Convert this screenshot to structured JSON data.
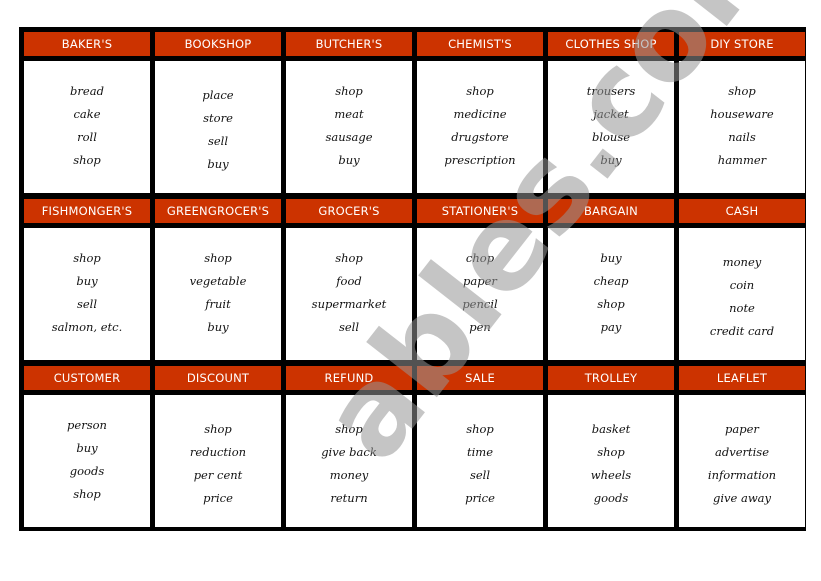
{
  "worksheet": {
    "watermark": "ables.com",
    "cards": [
      {
        "title": "BAKER'S",
        "words": [
          "bread",
          "cake",
          "roll",
          "shop"
        ]
      },
      {
        "title": "BOOKSHOP",
        "words": [
          "place",
          "store",
          "sell",
          "buy"
        ]
      },
      {
        "title": "BUTCHER'S",
        "words": [
          "shop",
          "meat",
          "sausage",
          "buy"
        ]
      },
      {
        "title": "CHEMIST'S",
        "words": [
          "shop",
          "medicine",
          "drugstore",
          "prescription"
        ]
      },
      {
        "title": "CLOTHES SHOP",
        "words": [
          "trousers",
          "jacket",
          "blouse",
          "buy"
        ]
      },
      {
        "title": "DIY STORE",
        "words": [
          "shop",
          "houseware",
          "nails",
          "hammer"
        ]
      },
      {
        "title": "FISHMONGER'S",
        "words": [
          "shop",
          "buy",
          "sell",
          "salmon, etc."
        ]
      },
      {
        "title": "GREENGROCER'S",
        "words": [
          "shop",
          "vegetable",
          "fruit",
          "buy"
        ]
      },
      {
        "title": "GROCER'S",
        "words": [
          "shop",
          "food",
          "supermarket",
          "sell"
        ]
      },
      {
        "title": "STATIONER'S",
        "words": [
          "chop",
          "paper",
          "pencil",
          "pen"
        ]
      },
      {
        "title": "BARGAIN",
        "words": [
          "buy",
          "cheap",
          "shop",
          "pay"
        ]
      },
      {
        "title": "CASH",
        "words": [
          "money",
          "coin",
          "note",
          "credit card"
        ]
      },
      {
        "title": "CUSTOMER",
        "words": [
          "person",
          "buy",
          "goods",
          "shop"
        ]
      },
      {
        "title": "DISCOUNT",
        "words": [
          "shop",
          "reduction",
          "per cent",
          "price"
        ]
      },
      {
        "title": "REFUND",
        "words": [
          "shop",
          "give back",
          "money",
          "return"
        ]
      },
      {
        "title": "SALE",
        "words": [
          "shop",
          "time",
          "sell",
          "price"
        ]
      },
      {
        "title": "TROLLEY",
        "words": [
          "basket",
          "shop",
          "wheels",
          "goods"
        ]
      },
      {
        "title": "LEAFLET",
        "words": [
          "paper",
          "advertise",
          "information",
          "give away"
        ]
      }
    ]
  },
  "colors": {
    "header_bg": "#cc3300",
    "header_text": "#ffffff",
    "frame": "#000000"
  }
}
